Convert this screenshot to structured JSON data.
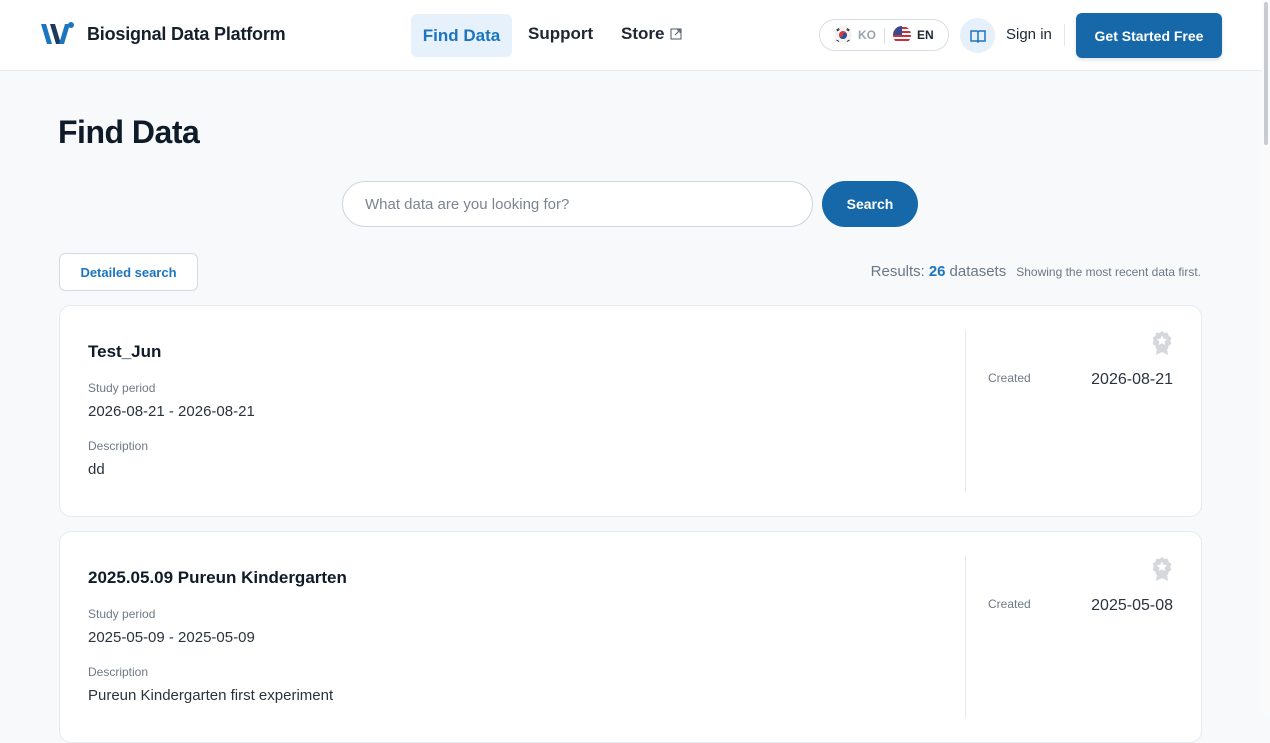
{
  "header": {
    "brand": "Biosignal Data Platform",
    "nav": {
      "find_data": "Find Data",
      "support": "Support",
      "store": "Store"
    },
    "lang": {
      "ko": "KO",
      "en": "EN",
      "active": "EN"
    },
    "sign_in": "Sign in",
    "cta": "Get Started Free"
  },
  "main": {
    "title": "Find Data",
    "search": {
      "placeholder": "What data are you looking for?",
      "value": "",
      "button": "Search"
    },
    "detailed_search": "Detailed search",
    "results": {
      "label": "Results:",
      "count": "26",
      "unit": "datasets",
      "note": "Showing the most recent data first."
    },
    "datasets": [
      {
        "title": "Test_Jun",
        "period_label": "Study period",
        "period": "2026-08-21 - 2026-08-21",
        "desc_label": "Description",
        "description": "dd",
        "created_label": "Created",
        "created": "2026-08-21"
      },
      {
        "title": "2025.05.09 Pureun Kindergarten",
        "period_label": "Study period",
        "period": "2025-05-09 - 2025-05-09",
        "desc_label": "Description",
        "description": "Pureun Kindergarten first experiment",
        "created_label": "Created",
        "created": "2025-05-08"
      }
    ]
  },
  "colors": {
    "brand_blue": "#1668a9",
    "accent_blue": "#1b75c0",
    "nav_active_bg": "#e6f1fb"
  }
}
